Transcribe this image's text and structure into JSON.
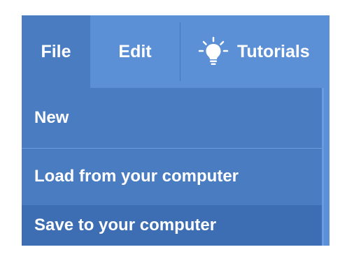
{
  "menubar": {
    "file_label": "File",
    "edit_label": "Edit",
    "tutorials_label": "Tutorials",
    "tutorials_icon": "lightbulb-icon"
  },
  "file_menu": {
    "items": [
      {
        "label": "New"
      },
      {
        "label": "Load from your computer"
      },
      {
        "label": "Save to your computer"
      }
    ],
    "highlighted_item": "Save to your computer"
  },
  "colors": {
    "menubar_bg": "#5b8fd6",
    "active_menu_bg": "#4a7cc2",
    "hover_item_bg": "#3d6db3",
    "text": "#ffffff"
  }
}
